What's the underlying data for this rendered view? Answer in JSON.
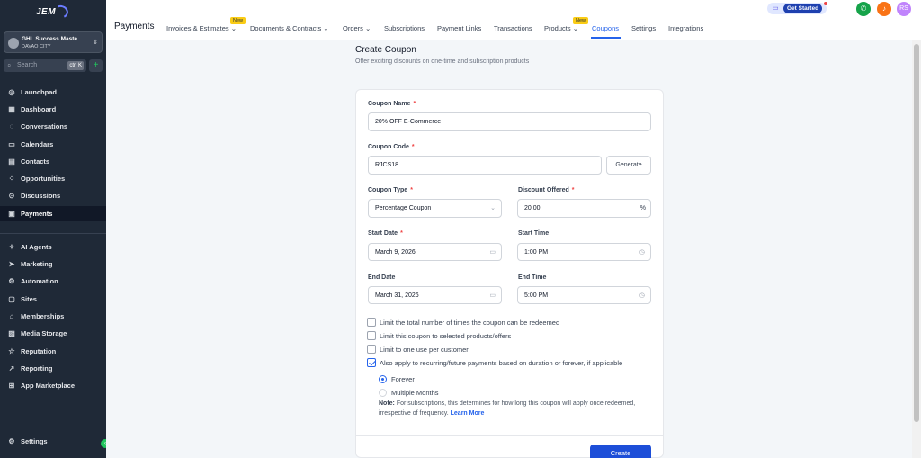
{
  "sidebar": {
    "logo_text": "JEM",
    "account": {
      "name": "GHL Success Maste...",
      "location": "DAVAO CITY"
    },
    "search": {
      "placeholder": "Search",
      "shortcut": "ctrl K"
    },
    "items_top": [
      {
        "label": "Launchpad",
        "icon": "rocket-icon"
      },
      {
        "label": "Dashboard",
        "icon": "dashboard-icon"
      },
      {
        "label": "Conversations",
        "icon": "chat-icon"
      },
      {
        "label": "Calendars",
        "icon": "calendar-icon"
      },
      {
        "label": "Contacts",
        "icon": "contacts-icon"
      },
      {
        "label": "Opportunities",
        "icon": "opportunities-icon"
      },
      {
        "label": "Discussions",
        "icon": "discussions-icon"
      },
      {
        "label": "Payments",
        "icon": "payments-icon"
      }
    ],
    "items_bottom": [
      {
        "label": "AI Agents",
        "icon": "sparkle-icon"
      },
      {
        "label": "Marketing",
        "icon": "send-icon"
      },
      {
        "label": "Automation",
        "icon": "automation-icon"
      },
      {
        "label": "Sites",
        "icon": "sites-icon"
      },
      {
        "label": "Memberships",
        "icon": "memberships-icon"
      },
      {
        "label": "Media Storage",
        "icon": "media-icon"
      },
      {
        "label": "Reputation",
        "icon": "star-icon"
      },
      {
        "label": "Reporting",
        "icon": "chart-icon"
      },
      {
        "label": "App Marketplace",
        "icon": "grid-icon"
      }
    ],
    "settings_label": "Settings"
  },
  "topnav": {
    "title": "Payments",
    "tabs": [
      {
        "label": "Invoices & Estimates",
        "has_dropdown": true,
        "badge": "New"
      },
      {
        "label": "Documents & Contracts",
        "has_dropdown": true
      },
      {
        "label": "Orders",
        "has_dropdown": true
      },
      {
        "label": "Subscriptions"
      },
      {
        "label": "Payment Links"
      },
      {
        "label": "Transactions"
      },
      {
        "label": "Products",
        "has_dropdown": true,
        "badge": "New"
      },
      {
        "label": "Coupons",
        "active": true
      },
      {
        "label": "Settings"
      },
      {
        "label": "Integrations"
      }
    ],
    "get_started_label": "Get Started",
    "avatar_initials": "RS",
    "colors": {
      "phone": "#16a34a",
      "bell": "#f97316",
      "avatar": "#c084fc",
      "accent": "#2563eb"
    }
  },
  "page": {
    "title": "Create Coupon",
    "subtitle": "Offer exciting discounts on one-time and subscription products"
  },
  "form": {
    "coupon_name": {
      "label": "Coupon Name",
      "required": "*",
      "value": "20% OFF E-Commerce"
    },
    "coupon_code": {
      "label": "Coupon Code",
      "required": "*",
      "value": "RJCS18",
      "generate_label": "Generate"
    },
    "coupon_type": {
      "label": "Coupon Type",
      "required": "*",
      "value": "Percentage Coupon"
    },
    "discount": {
      "label": "Discount Offered",
      "required": "*",
      "value": "20.00",
      "suffix": "%"
    },
    "start_date": {
      "label": "Start Date",
      "required": "*",
      "value": "March 9, 2026"
    },
    "start_time": {
      "label": "Start Time",
      "value": "1:00 PM"
    },
    "end_date": {
      "label": "End Date",
      "value": "March 31, 2026"
    },
    "end_time": {
      "label": "End Time",
      "value": "5:00 PM"
    },
    "checkboxes": [
      {
        "label": "Limit the total number of times the coupon can be redeemed",
        "checked": false
      },
      {
        "label": "Limit this coupon to selected products/offers",
        "checked": false
      },
      {
        "label": "Limit to one use per customer",
        "checked": false
      },
      {
        "label": "Also apply to recurring/future payments based on duration or forever, if applicable",
        "checked": true
      }
    ],
    "duration_options": [
      {
        "label": "Forever",
        "selected": true
      },
      {
        "label": "Multiple Months",
        "selected": false
      }
    ],
    "note": {
      "prefix": "Note:",
      "text": " For subscriptions, this determines for how long this coupon will apply once redeemed, irrespective of frequency. ",
      "link": "Learn More"
    },
    "create_label": "Create"
  }
}
